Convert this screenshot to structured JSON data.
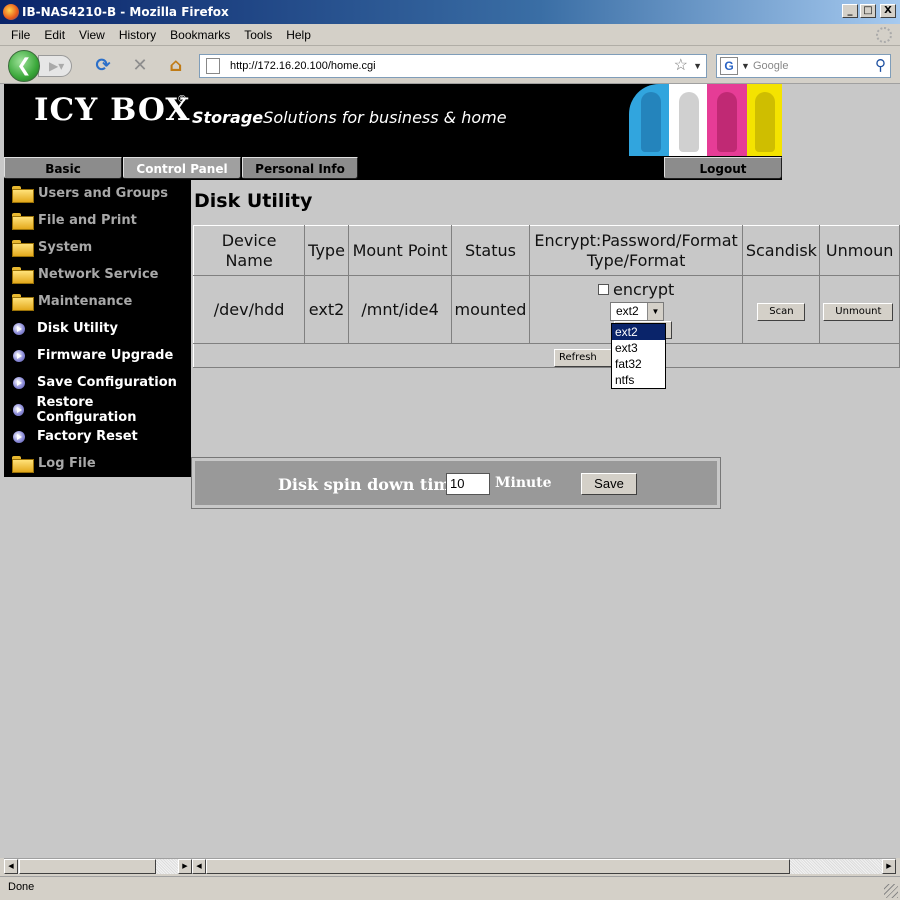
{
  "window": {
    "title": "IB-NAS4210-B - Mozilla Firefox",
    "buttons": [
      "_",
      "□",
      "X"
    ]
  },
  "menu": [
    "File",
    "Edit",
    "View",
    "History",
    "Bookmarks",
    "Tools",
    "Help"
  ],
  "toolbar": {
    "url": "http://172.16.20.100/home.cgi",
    "search_placeholder": "Google",
    "search_engine_letter": "G",
    "icons": [
      "back-icon",
      "forward-icon",
      "reload-icon",
      "stop-icon",
      "home-icon",
      "bookmark-star-icon",
      "search-icon"
    ]
  },
  "banner": {
    "logo": "ICY BOX",
    "registered": "®",
    "tagline_bold": "Storage",
    "tagline_rest": "Solutions for business & home"
  },
  "tabs": [
    {
      "label": "Basic",
      "active": false
    },
    {
      "label": "Control Panel",
      "active": true
    },
    {
      "label": "Personal Info",
      "active": false
    },
    {
      "label": "Logout",
      "active": false
    }
  ],
  "sidebar": [
    {
      "label": "Users and Groups",
      "type": "folder"
    },
    {
      "label": "File and Print",
      "type": "folder"
    },
    {
      "label": "System",
      "type": "folder"
    },
    {
      "label": "Network Service",
      "type": "folder"
    },
    {
      "label": "Maintenance",
      "type": "folder"
    },
    {
      "label": "Disk Utility",
      "type": "page"
    },
    {
      "label": "Firmware Upgrade",
      "type": "page"
    },
    {
      "label": "Save Configuration",
      "type": "page"
    },
    {
      "label": "Restore Configuration",
      "type": "page"
    },
    {
      "label": "Factory Reset",
      "type": "page"
    },
    {
      "label": "Log File",
      "type": "folder"
    }
  ],
  "main": {
    "title": "Disk Utility",
    "table": {
      "headers": [
        "Device Name",
        "Type",
        "Mount Point",
        "Status",
        "Encrypt:Password/Format Type/Format",
        "Scandisk",
        "Unmoun"
      ],
      "row": {
        "device": "/dev/hdd",
        "type": "ext2",
        "mount": "/mnt/ide4",
        "status": "mounted",
        "encrypt_label": "encrypt",
        "encrypt_checked": false,
        "format_selected": "ext2",
        "scan_label": "Scan",
        "unmount_label": "Unmount"
      },
      "refresh_label": "Refresh"
    },
    "format_options": [
      "ext2",
      "ext3",
      "fat32",
      "ntfs"
    ],
    "spin": {
      "label": "Disk spin down time:",
      "value": "10",
      "unit": "Minute",
      "save_label": "Save"
    }
  },
  "status": {
    "text": "Done"
  }
}
